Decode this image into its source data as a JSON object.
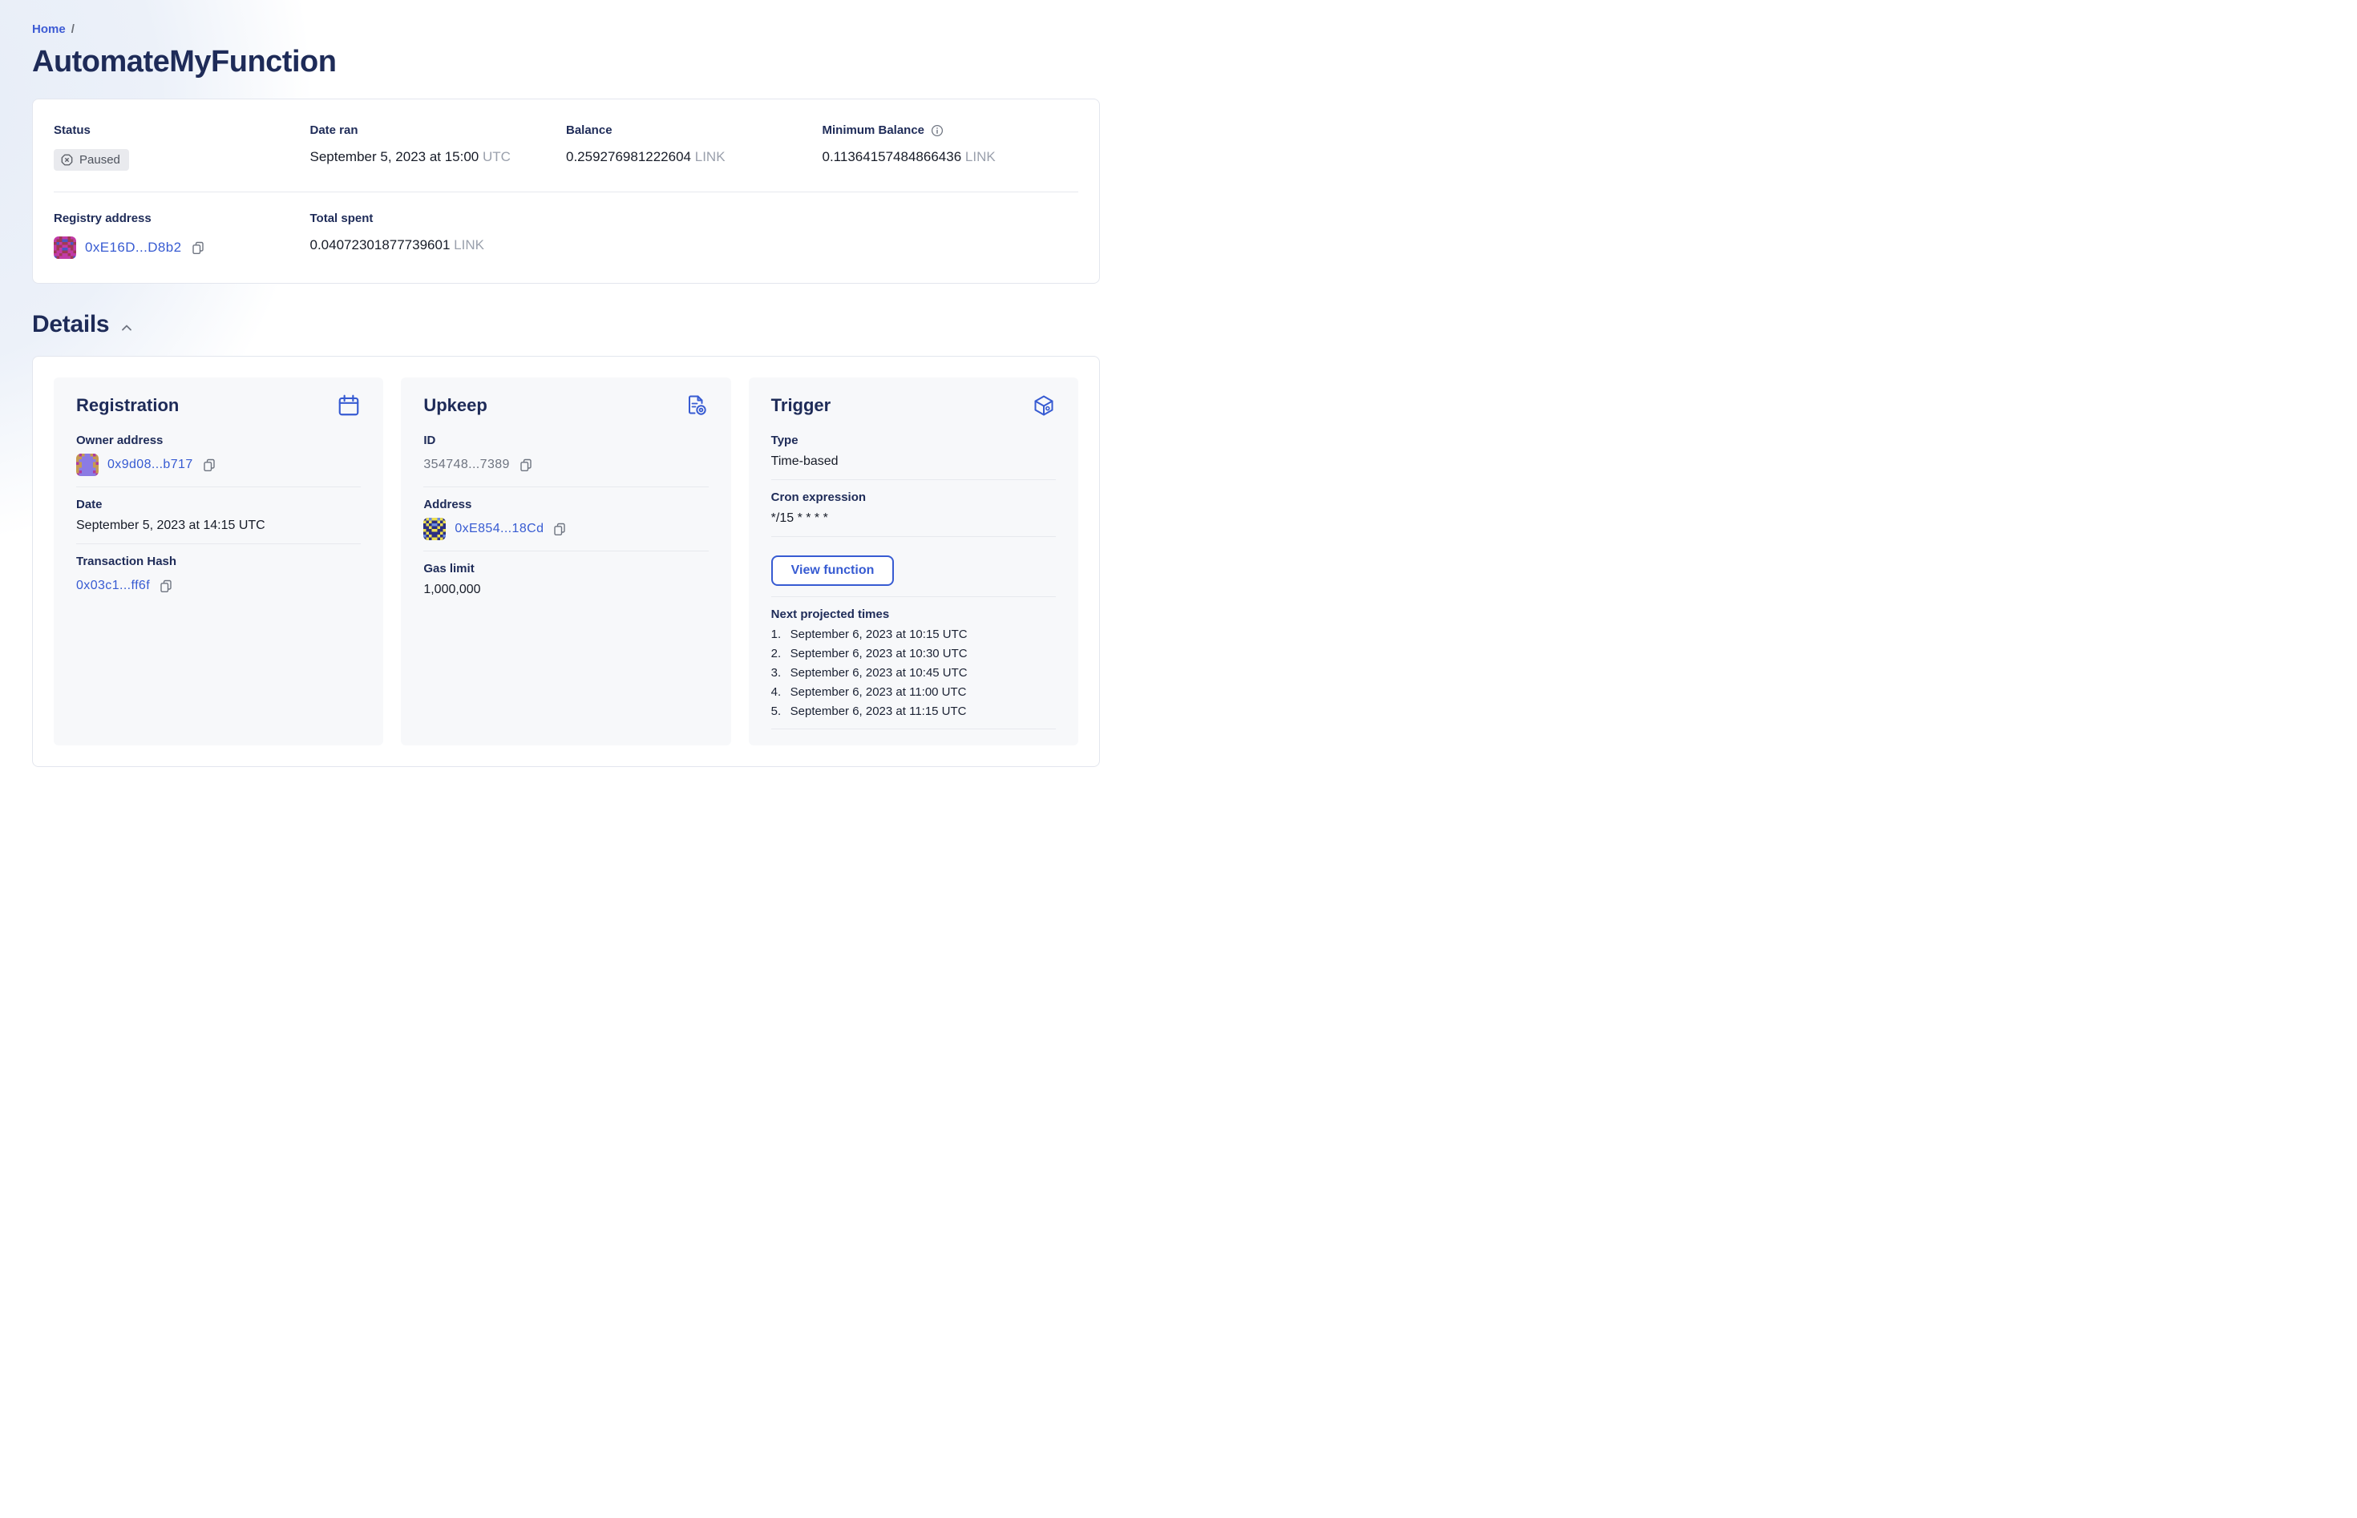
{
  "breadcrumb": {
    "home": "Home",
    "separator": "/"
  },
  "page_title": "AutomateMyFunction",
  "summary": {
    "status": {
      "label": "Status",
      "value": "Paused",
      "icon": "paused-octagon-x-icon"
    },
    "date_ran": {
      "label": "Date ran",
      "value": "September 5, 2023 at 15:00",
      "suffix": "UTC"
    },
    "balance": {
      "label": "Balance",
      "value": "0.259276981222604",
      "suffix": "LINK"
    },
    "minimum_balance": {
      "label": "Minimum Balance",
      "value": "0.11364157484866436",
      "suffix": "LINK",
      "icon": "info-icon"
    },
    "registry_address": {
      "label": "Registry address",
      "value": "0xE16D...D8b2",
      "icon": "copy-icon"
    },
    "total_spent": {
      "label": "Total spent",
      "value": "0.04072301877739601",
      "suffix": "LINK"
    }
  },
  "details": {
    "heading": "Details",
    "collapse_icon": "chevron-up-icon",
    "registration": {
      "title": "Registration",
      "icon": "calendar-icon",
      "owner_address": {
        "label": "Owner address",
        "value": "0x9d08...b717",
        "icon": "copy-icon"
      },
      "date": {
        "label": "Date",
        "value": "September 5, 2023 at 14:15 UTC"
      },
      "transaction_hash": {
        "label": "Transaction Hash",
        "value": "0x03c1...ff6f",
        "icon": "copy-icon"
      }
    },
    "upkeep": {
      "title": "Upkeep",
      "icon": "document-gear-icon",
      "id": {
        "label": "ID",
        "value": "354748...7389",
        "icon": "copy-icon"
      },
      "address": {
        "label": "Address",
        "value": "0xE854...18Cd",
        "icon": "copy-icon"
      },
      "gas_limit": {
        "label": "Gas limit",
        "value": "1,000,000"
      }
    },
    "trigger": {
      "title": "Trigger",
      "icon": "cube-icon",
      "type": {
        "label": "Type",
        "value": "Time-based"
      },
      "cron": {
        "label": "Cron expression",
        "value": "*/15 * * * *"
      },
      "view_function_label": "View function",
      "next_projected": {
        "label": "Next projected times",
        "items": [
          {
            "n": "1.",
            "t": "September 6, 2023 at 10:15 UTC"
          },
          {
            "n": "2.",
            "t": "September 6, 2023 at 10:30 UTC"
          },
          {
            "n": "3.",
            "t": "September 6, 2023 at 10:45 UTC"
          },
          {
            "n": "4.",
            "t": "September 6, 2023 at 11:00 UTC"
          },
          {
            "n": "5.",
            "t": "September 6, 2023 at 11:15 UTC"
          }
        ]
      }
    }
  },
  "colors": {
    "accent_blue": "#375BD2",
    "link_blue": "#3D5BD4",
    "heading_navy": "#1E2B58",
    "text_dark": "#171C28",
    "muted_gray": "#9AA0AC",
    "id_gray": "#6E7480",
    "badge_bg": "#E9EAEE",
    "badge_text": "#4E535D",
    "card_border": "#E3E6EE",
    "divider": "#E7E9EE",
    "panel_bg": "#F7F8FA",
    "page_tint": "#ECF1F9"
  }
}
